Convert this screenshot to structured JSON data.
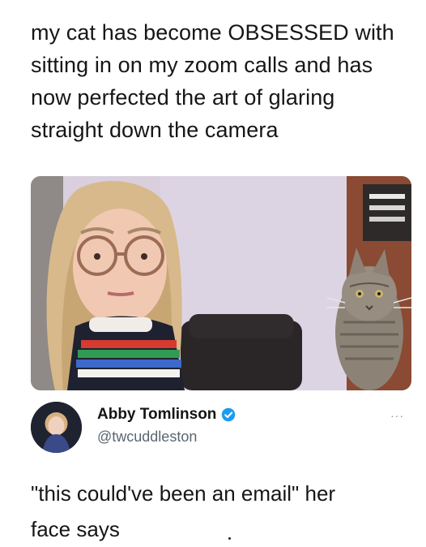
{
  "caption": {
    "text": "my cat has become OBSESSED with\nsitting in on my zoom calls and has\nnow perfected the art of glaring\nstraight down the camera"
  },
  "photo": {
    "subject": "woman with glasses and cat on video call"
  },
  "tweet": {
    "display_name": "Abby Tomlinson",
    "handle": "@twcuddleston",
    "verified": true,
    "more_label": "···",
    "text": "\"this could've been an email\" her\nface says"
  },
  "colors": {
    "verified_blue": "#1d9bf0",
    "handle_gray": "#5b6670",
    "background": "#ffffff",
    "text": "#161616"
  },
  "icons": {
    "verified": "verified-badge-icon",
    "more": "more-options-icon"
  }
}
